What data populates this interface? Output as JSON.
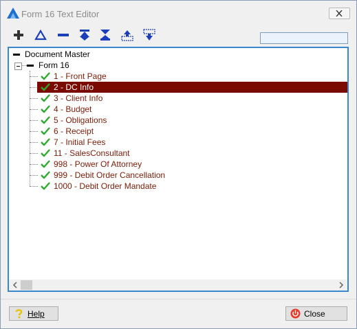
{
  "window": {
    "title": "Form 16 Text Editor"
  },
  "toolbar": {
    "buttons": [
      "add-icon",
      "edit-icon",
      "remove-icon",
      "move-top-icon",
      "move-bottom-icon",
      "move-up-icon",
      "move-down-icon"
    ],
    "search_value": ""
  },
  "tree": {
    "root_label": "Document Master",
    "form_label": "Form 16",
    "items": [
      {
        "label": "1 - Front Page",
        "checked": true
      },
      {
        "label": "2 - DC Info",
        "checked": true,
        "selected": true
      },
      {
        "label": "3 - Client Info",
        "checked": true
      },
      {
        "label": "4 - Budget",
        "checked": true
      },
      {
        "label": "5 - Obligations",
        "checked": true
      },
      {
        "label": "6 - Receipt",
        "checked": true
      },
      {
        "label": "7 - Initial Fees",
        "checked": true
      },
      {
        "label": "11 - SalesConsultant",
        "checked": true
      },
      {
        "label": "998 - Power Of Attorney",
        "checked": true
      },
      {
        "label": "999 - Debit Order Cancellation",
        "checked": true
      },
      {
        "label": "1000 - Debit Order Mandate",
        "checked": true
      }
    ]
  },
  "footer": {
    "help_label": "Help",
    "close_label": "Close"
  },
  "colors": {
    "selected_bg": "#7a0a00",
    "item_text": "#7a1c08",
    "check": "#2ea82e",
    "toolbar_blue": "#1a3fb8"
  }
}
